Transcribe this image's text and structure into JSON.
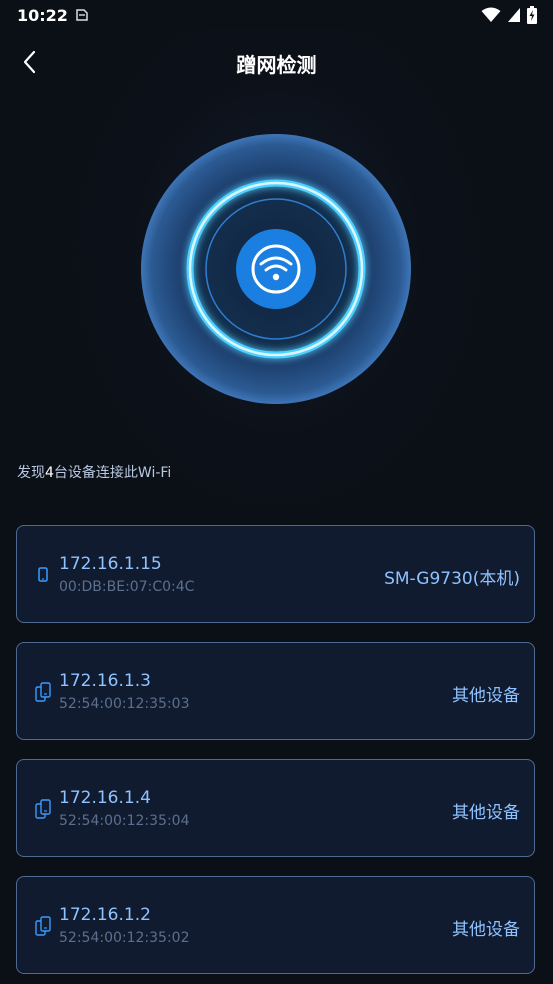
{
  "status_bar": {
    "time": "10:22",
    "icons": [
      "notification-icon",
      "wifi-icon",
      "signal-icon",
      "battery-charging-icon"
    ]
  },
  "header": {
    "title": "蹭网检测",
    "back_icon": "chevron-left-icon"
  },
  "scanner": {
    "icon": "wifi-icon",
    "colors": {
      "core": "#1a7fe0",
      "ring": "#40c4ff",
      "disc": "#1c3d6a"
    }
  },
  "summary": {
    "prefix": "发现",
    "count": "4",
    "suffix": "台设备连接此Wi-Fi"
  },
  "devices": [
    {
      "ip": "172.16.1.15",
      "mac": "00:DB:BE:07:C0:4C",
      "name": "SM-G9730(本机)",
      "icon": "phone-icon"
    },
    {
      "ip": "172.16.1.3",
      "mac": "52:54:00:12:35:03",
      "name": "其他设备",
      "icon": "devices-icon"
    },
    {
      "ip": "172.16.1.4",
      "mac": "52:54:00:12:35:04",
      "name": "其他设备",
      "icon": "devices-icon"
    },
    {
      "ip": "172.16.1.2",
      "mac": "52:54:00:12:35:02",
      "name": "其他设备",
      "icon": "devices-icon"
    }
  ]
}
